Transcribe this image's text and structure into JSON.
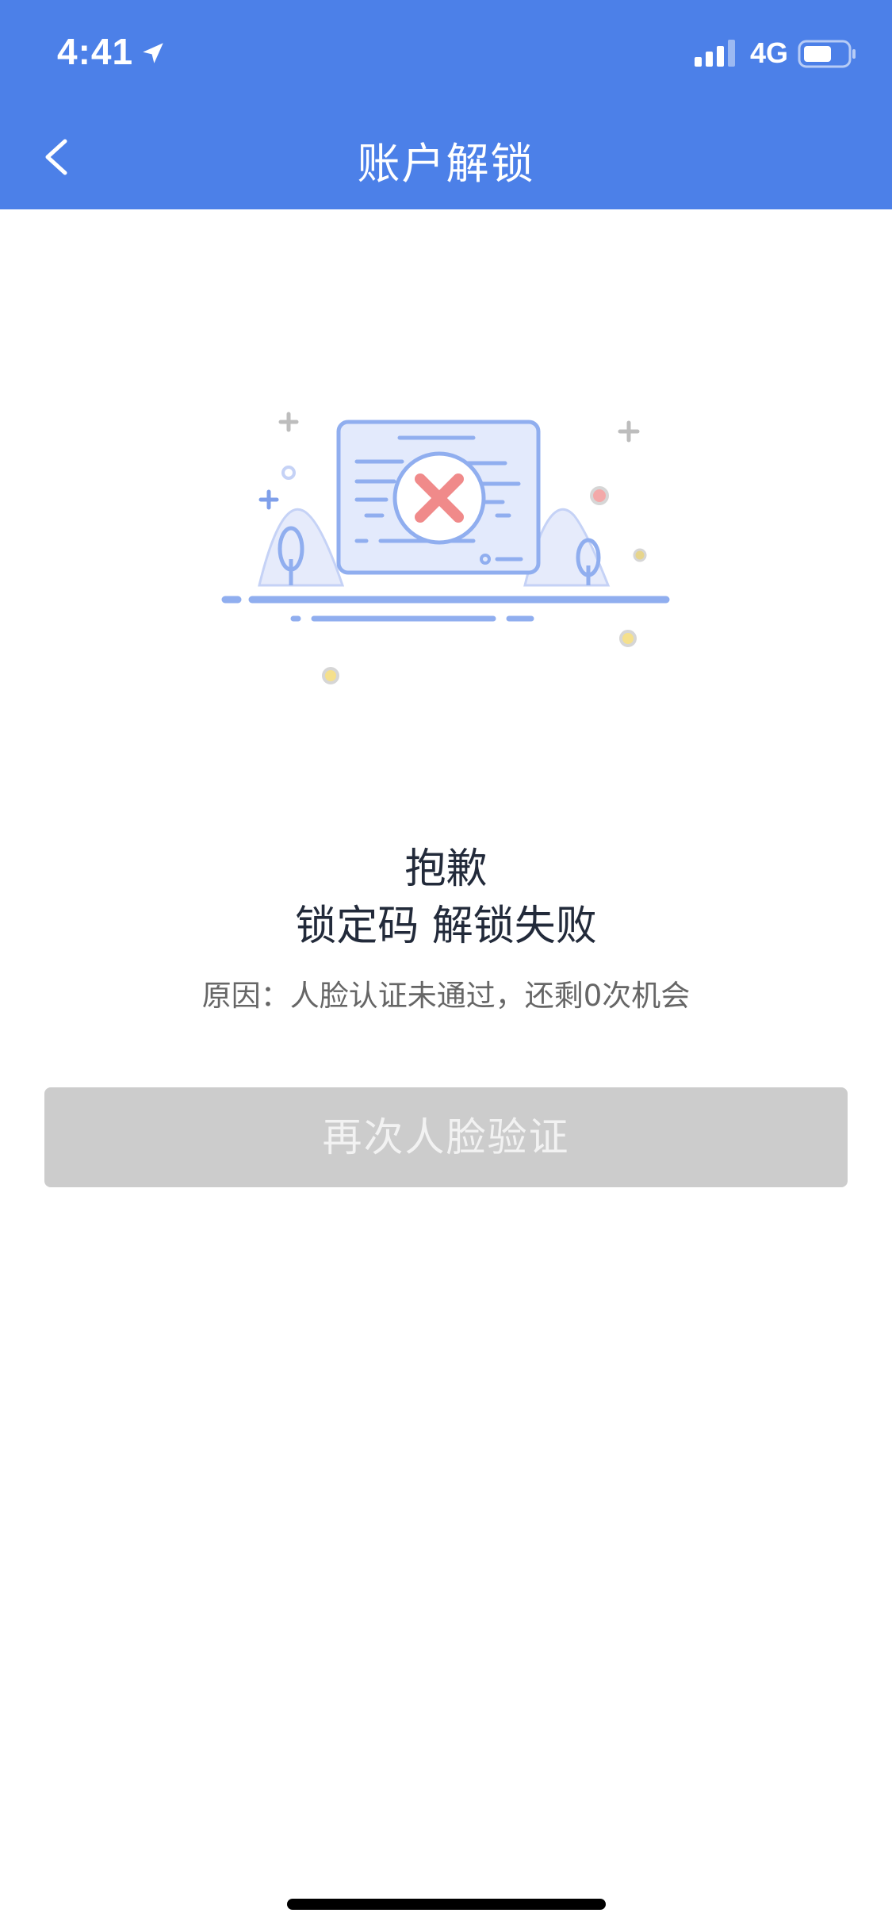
{
  "status_bar": {
    "time": "4:41",
    "network": "4G",
    "icons": [
      "location-arrow-icon",
      "signal-bars-icon",
      "battery-icon"
    ]
  },
  "nav": {
    "title": "账户解锁",
    "back_icon": "chevron-left-icon"
  },
  "result": {
    "title": "抱歉",
    "subtitle": "锁定码 解锁失败",
    "reason": "原因：人脸认证未通过，还剩0次机会"
  },
  "actions": {
    "retry_label": "再次人脸验证"
  },
  "colors": {
    "header_bg": "#4C80E8",
    "button_disabled_bg": "#CCCCCC",
    "error_red": "#F08A8A",
    "illustration_blue": "#90AEEF"
  }
}
